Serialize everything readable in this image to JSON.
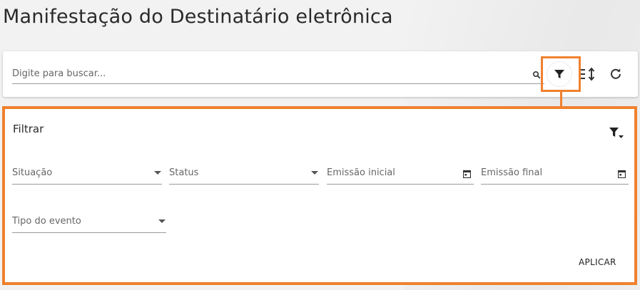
{
  "page": {
    "title": "Manifestação do Destinatário eletrônica"
  },
  "search": {
    "placeholder": "Digite para buscar...",
    "icons": [
      "search-icon",
      "filter-icon",
      "sort-icon",
      "refresh-icon"
    ]
  },
  "filter_panel": {
    "title": "Filtrar",
    "fields": {
      "situacao": {
        "label": "Situação",
        "type": "select"
      },
      "status": {
        "label": "Status",
        "type": "select"
      },
      "emissao_inicial": {
        "label": "Emissão inicial",
        "type": "date"
      },
      "emissao_final": {
        "label": "Emissão final",
        "type": "date"
      },
      "tipo_evento": {
        "label": "Tipo do evento",
        "type": "select"
      }
    },
    "apply_label": "APLICAR"
  },
  "colors": {
    "highlight": "#f0812f",
    "background": "#f2f2f2",
    "card": "#ffffff"
  }
}
